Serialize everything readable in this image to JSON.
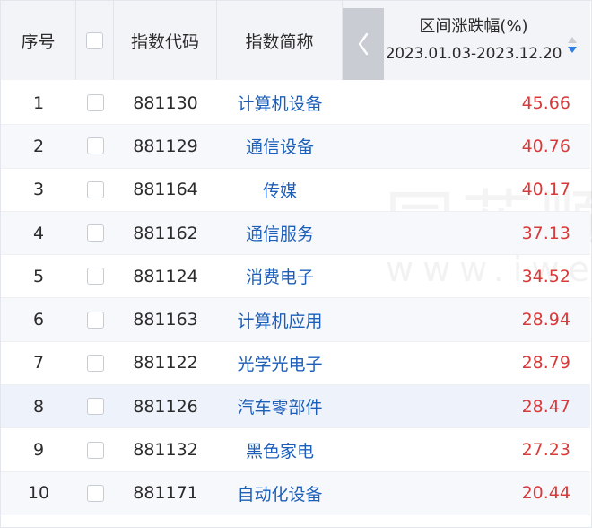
{
  "header": {
    "seq_label": "序号",
    "code_label": "指数代码",
    "name_label": "指数简称",
    "range_title": "区间涨跌幅(%)",
    "range_dates": "2023.01.03-2023.12.20",
    "prev_icon": "chevron-left-icon",
    "sort_icon": "sort-icon"
  },
  "colors": {
    "name_link": "#1d5fb8",
    "value_up": "#d83a3a",
    "header_bg": "#f3f4f7"
  },
  "rows": [
    {
      "seq": "1",
      "code": "881130",
      "name": "计算机设备",
      "value": "45.66"
    },
    {
      "seq": "2",
      "code": "881129",
      "name": "通信设备",
      "value": "40.76"
    },
    {
      "seq": "3",
      "code": "881164",
      "name": "传媒",
      "value": "40.17"
    },
    {
      "seq": "4",
      "code": "881162",
      "name": "通信服务",
      "value": "37.13"
    },
    {
      "seq": "5",
      "code": "881124",
      "name": "消费电子",
      "value": "34.52"
    },
    {
      "seq": "6",
      "code": "881163",
      "name": "计算机应用",
      "value": "28.94"
    },
    {
      "seq": "7",
      "code": "881122",
      "name": "光学光电子",
      "value": "28.79"
    },
    {
      "seq": "8",
      "code": "881126",
      "name": "汽车零部件",
      "value": "28.47"
    },
    {
      "seq": "9",
      "code": "881132",
      "name": "黑色家电",
      "value": "27.23"
    },
    {
      "seq": "10",
      "code": "881171",
      "name": "自动化设备",
      "value": "20.44"
    }
  ],
  "watermark": {
    "brand": "同花顺",
    "url": "www.iwen"
  }
}
